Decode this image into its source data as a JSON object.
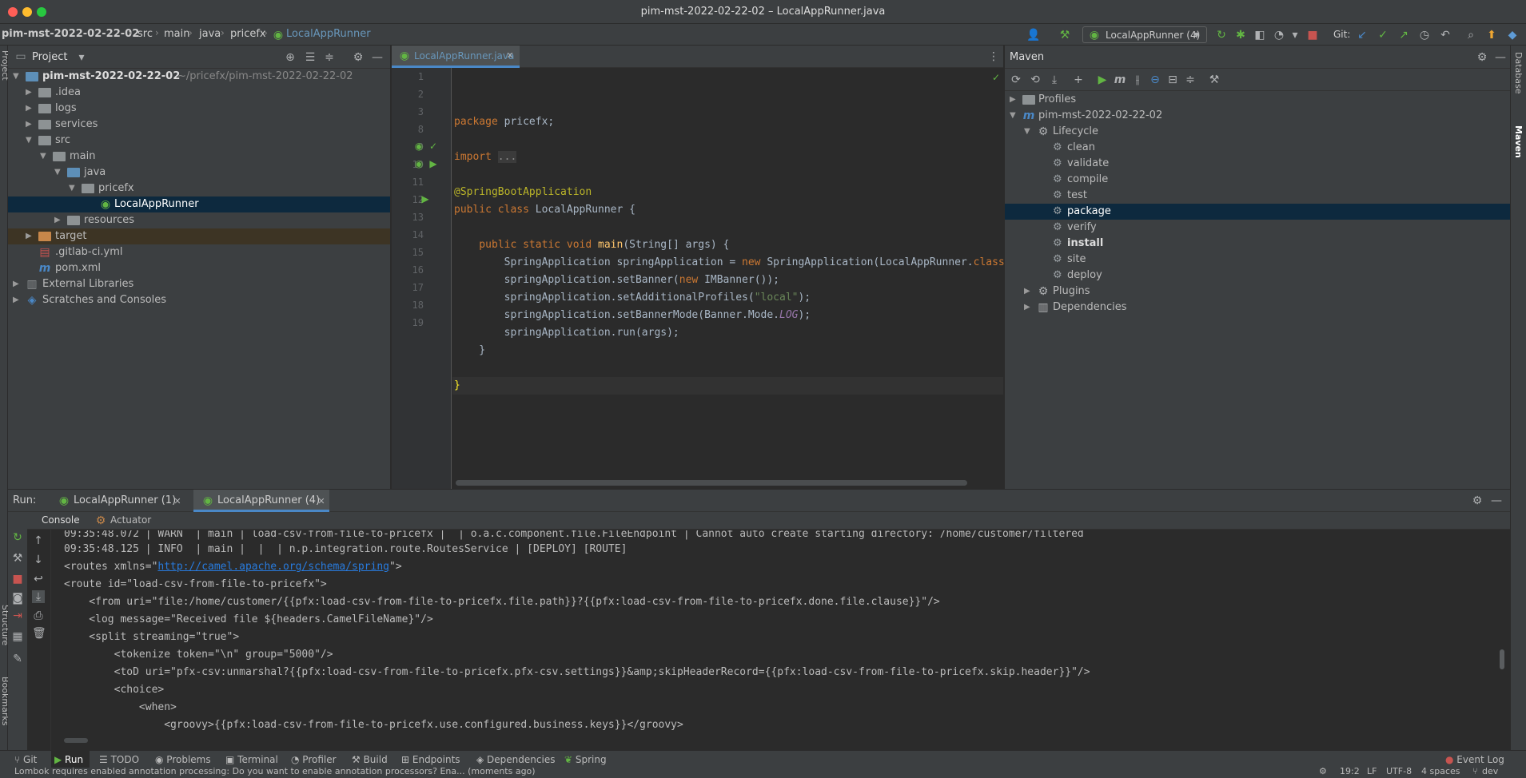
{
  "window": {
    "title": "pim-mst-2022-02-22-02 – LocalAppRunner.java"
  },
  "breadcrumb": [
    "pim-mst-2022-02-22-02",
    "src",
    "main",
    "java",
    "pricefx",
    "LocalAppRunner"
  ],
  "toolbar": {
    "run_config": "LocalAppRunner (4)",
    "git_label": "Git:"
  },
  "project": {
    "title": "Project",
    "rows": [
      {
        "label": "pim-mst-2022-02-22-02",
        "extra": "~/pricefx/pim-mst-2022-02-22-02"
      },
      {
        "label": ".idea"
      },
      {
        "label": "logs"
      },
      {
        "label": "services"
      },
      {
        "label": "src"
      },
      {
        "label": "main"
      },
      {
        "label": "java"
      },
      {
        "label": "pricefx"
      },
      {
        "label": "LocalAppRunner"
      },
      {
        "label": "resources"
      },
      {
        "label": "target"
      },
      {
        "label": ".gitlab-ci.yml"
      },
      {
        "label": "pom.xml"
      },
      {
        "label": "External Libraries"
      },
      {
        "label": "Scratches and Consoles"
      }
    ]
  },
  "editor": {
    "tab": "LocalAppRunner.java",
    "line_numbers": [
      "1",
      "2",
      "3",
      "8",
      "9",
      "10",
      "11",
      "12",
      "13",
      "14",
      "15",
      "16",
      "17",
      "18",
      "19"
    ],
    "lines": {
      "l1a": "package ",
      "l1b": "pricefx;",
      "l3a": "import ",
      "l3b": "...",
      "l8": "@SpringBootApplication",
      "l9a": "public class ",
      "l9b": "LocalAppRunner {",
      "l11a": "    public static void ",
      "l11b": "main",
      "l11c": "(String[] args) {",
      "l12a": "        SpringApplication springApplication = ",
      "l12b": "new ",
      "l12c": "SpringApplication(LocalAppRunner.",
      "l12d": "class",
      "l13a": "        springApplication.setBanner(",
      "l13b": "new ",
      "l13c": "IMBanner());",
      "l14a": "        springApplication.setAdditionalProfiles(",
      "l14b": "\"local\"",
      "l14c": ");",
      "l15a": "        springApplication.setBannerMode(Banner.Mode.",
      "l15b": "LOG",
      "l15c": ");",
      "l16": "        springApplication.run(args);",
      "l17": "    }",
      "l19": "}"
    }
  },
  "maven": {
    "title": "Maven",
    "rows": [
      {
        "label": "Profiles"
      },
      {
        "label": "pim-mst-2022-02-22-02"
      },
      {
        "label": "Lifecycle"
      },
      {
        "label": "clean"
      },
      {
        "label": "validate"
      },
      {
        "label": "compile"
      },
      {
        "label": "test"
      },
      {
        "label": "package"
      },
      {
        "label": "verify"
      },
      {
        "label": "install"
      },
      {
        "label": "site"
      },
      {
        "label": "deploy"
      },
      {
        "label": "Plugins"
      },
      {
        "label": "Dependencies"
      }
    ]
  },
  "run": {
    "label": "Run:",
    "tabs": [
      "LocalAppRunner (1)",
      "LocalAppRunner (4)"
    ],
    "subtabs": [
      "Console",
      "Actuator"
    ],
    "output": [
      "09:35:48.072 | WARN  | main | load-csv-from-file-to-pricefx |  | o.a.c.component.file.FileEndpoint | Cannot auto create starting directory: /home/customer/filtered",
      "09:35:48.125 | INFO  | main |  |  | n.p.integration.route.RoutesService | [DEPLOY] [ROUTE]",
      "<routes xmlns=\"",
      "<route id=\"load-csv-from-file-to-pricefx\">",
      "    <from uri=\"file:/home/customer/{{pfx:load-csv-from-file-to-pricefx.file.path}}?{{pfx:load-csv-from-file-to-pricefx.done.file.clause}}\"/>",
      "    <log message=\"Received file ${headers.CamelFileName}\"/>",
      "    <split streaming=\"true\">",
      "        <tokenize token=\"\\n\" group=\"5000\"/>",
      "        <toD uri=\"pfx-csv:unmarshal?{{pfx:load-csv-from-file-to-pricefx.pfx-csv.settings}}&amp;skipHeaderRecord={{pfx:load-csv-from-file-to-pricefx.skip.header}}\"/>",
      "        <choice>",
      "            <when>",
      "                <groovy>{{pfx:load-csv-from-file-to-pricefx.use.configured.business.keys}}</groovy>"
    ],
    "link": "http://camel.apache.org/schema/spring",
    "link_tail": "\">"
  },
  "bottom_tools": [
    "Git",
    "Run",
    "TODO",
    "Problems",
    "Terminal",
    "Profiler",
    "Build",
    "Endpoints",
    "Dependencies",
    "Spring",
    "Event Log"
  ],
  "side_labels": {
    "left_top": "Project",
    "left_mid": "Structure",
    "left_bot": "Bookmarks",
    "right_top": "Database",
    "right_mid": "Maven"
  },
  "status": {
    "message": "Lombok requires enabled annotation processing: Do you want to enable annotation processors? Ena... (moments ago)",
    "position": "19:2",
    "line_sep": "LF",
    "encoding": "UTF-8",
    "indent": "4 spaces",
    "branch": "dev"
  },
  "colors": {
    "accent": "#4a88c7",
    "selection": "#0d293e",
    "excluded": "#3d3424"
  }
}
